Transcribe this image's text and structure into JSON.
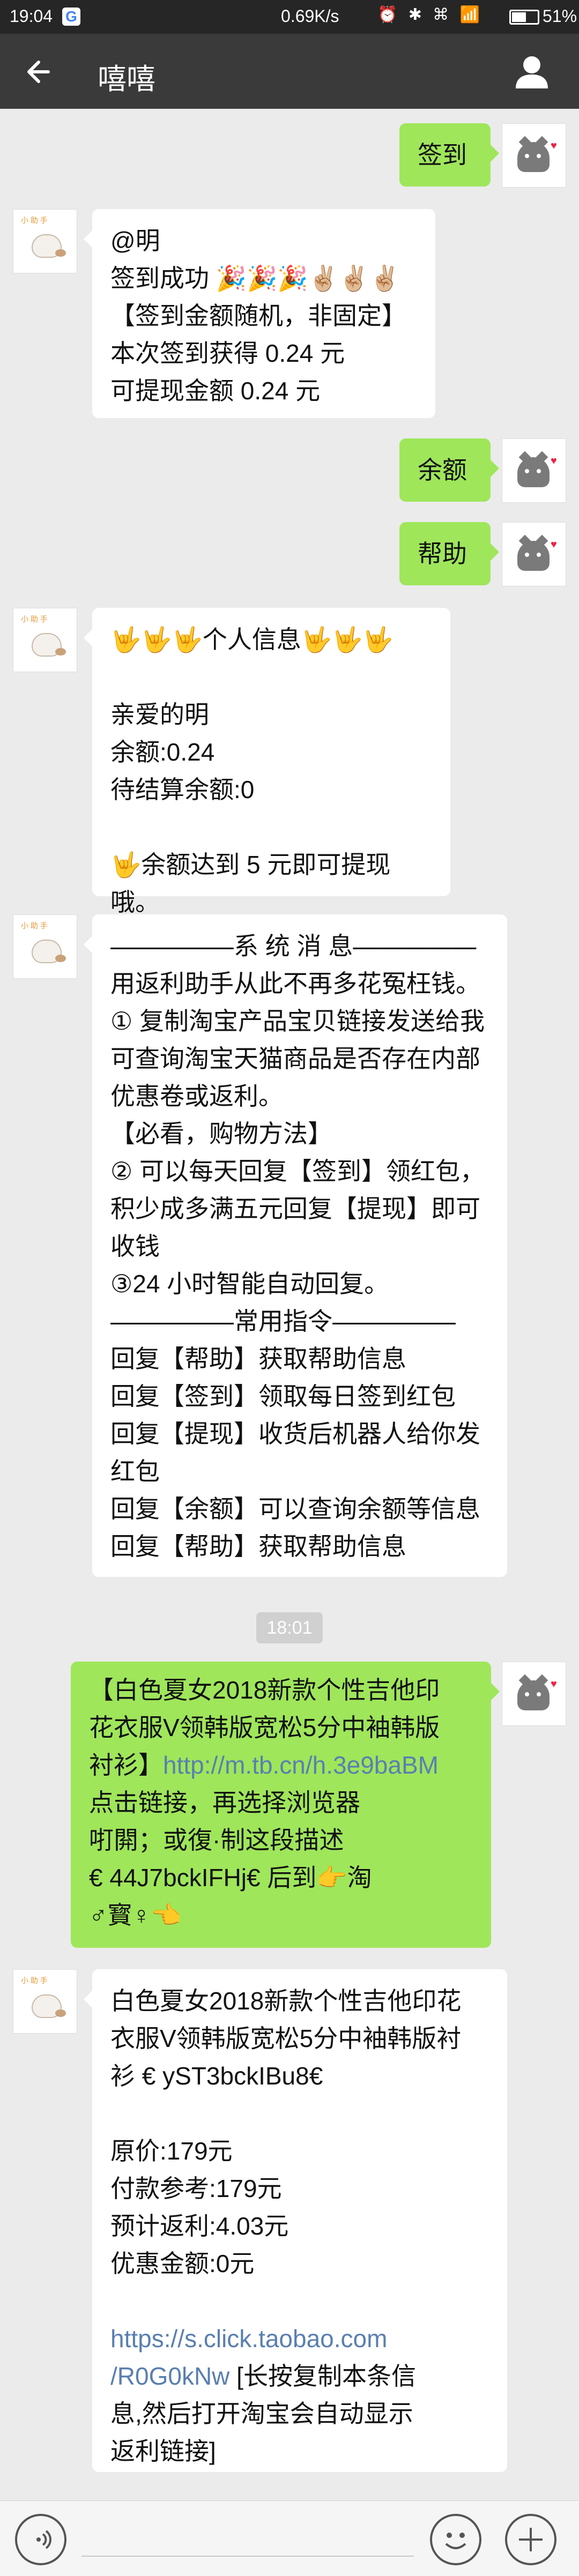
{
  "status_bar": {
    "time": "19:04",
    "net_speed": "0.69K/s",
    "battery": "51%"
  },
  "header": {
    "title": "嘻嘻"
  },
  "messages": {
    "m1": {
      "lines": [
        "签到"
      ]
    },
    "m2": {
      "lines": [
        "@明",
        "签到成功 🎉🎉🎉✌🏼✌🏼✌🏼",
        "【签到金额随机，非固定】",
        "本次签到获得 0.24 元",
        "可提现金额 0.24 元"
      ]
    },
    "m3": {
      "lines": [
        "余额"
      ]
    },
    "m4": {
      "lines": [
        "帮助"
      ]
    },
    "m5": {
      "lines": [
        "🤟🤟🤟个人信息🤟🤟🤟",
        "",
        "亲爱的明",
        "余额:0.24",
        "待结算余额:0",
        "",
        "🤟余额达到 5 元即可提现哦。"
      ]
    },
    "m6": {
      "lines": [
        "—————系 统 消 息—————",
        "用返利助手从此不再多花冤枉钱。",
        "① 复制淘宝产品宝贝链接发送给我",
        "可查询淘宝天猫商品是否存在内部",
        "优惠卷或返利。",
        "【必看，购物方法】",
        "② 可以每天回复【签到】领红包，",
        "积少成多满五元回复【提现】即可",
        "收钱",
        "③24 小时智能自动回复。",
        "—————常用指令—————",
        "回复【帮助】获取帮助信息",
        "回复【签到】领取每日签到红包",
        "回复【提现】收货后机器人给你发",
        "红包",
        "回复【余额】可以查询余额等信息",
        "回复【帮助】获取帮助信息"
      ]
    },
    "timestamp": "18:01",
    "m7": {
      "line1": "【白色夏女2018新款个性吉他印",
      "line2": "花衣服V领韩版宽松5分中袖韩版",
      "line3_text": "衬衫】",
      "line3_link": "http://m.tb.cn/h.3e9baBM",
      "line4": "点击链接，再选择浏览器",
      "line5": "咑閞；或復·制这段描述",
      "line6": "€ 44J7bckIFHj€ 后到👉淘",
      "line7": "♂寳♀👈"
    },
    "m8": {
      "lines": [
        "白色夏女2018新款个性吉他印花",
        "衣服V领韩版宽松5分中袖韩版衬",
        "衫 € yST3bckIBu8€",
        "",
        "原价:179元",
        "付款参考:179元",
        "预计返利:4.03元",
        "优惠金额:0元",
        ""
      ],
      "link1": "https://s.click.taobao.com",
      "link2": "/R0G0kNw",
      "link2_rest": " [长按复制本条信",
      "tail1": "息,然后打开淘宝会自动显示",
      "tail2": "返利链接]"
    }
  }
}
